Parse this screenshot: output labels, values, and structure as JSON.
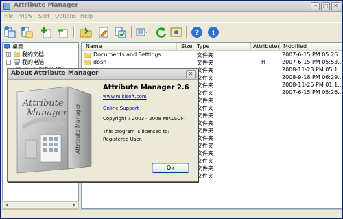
{
  "window": {
    "title": "Attribute Manager"
  },
  "title_buttons": {
    "minimize": "─",
    "maximize": "□",
    "close": "✕"
  },
  "menu": [
    "File",
    "View",
    "Sort",
    "Options",
    "Help"
  ],
  "toolbar_icons": [
    "copy-attributes-icon",
    "paste-attributes-icon",
    "add-icon",
    "remove-icon",
    "open-folder-icon",
    "edit-icon",
    "apply-icon",
    "view-options-icon",
    "refresh-icon",
    "settings-icon",
    "help-icon",
    "info-icon"
  ],
  "tree": {
    "items": [
      {
        "label": "桌面",
        "level": 0,
        "expander": ""
      },
      {
        "label": "我的文档",
        "level": 1,
        "expander": "+"
      },
      {
        "label": "我的电脑",
        "level": 1,
        "expander": "−"
      },
      {
        "label": "本地磁盘 (C:)",
        "level": 2,
        "expander": "+"
      }
    ]
  },
  "list": {
    "columns": [
      "Name",
      "Size",
      "Type",
      "Attributes",
      "Modified"
    ],
    "rows": [
      {
        "name": "Documents and Settings",
        "size": "",
        "type": "文件夹",
        "attributes": "",
        "modified": "2007-6-15 PM 05:26..."
      },
      {
        "name": "dosh",
        "size": "",
        "type": "文件夹",
        "attributes": "H",
        "modified": "2007-6-15 PM 05:53..."
      },
      {
        "name": "",
        "size": "",
        "type": "文件夹",
        "attributes": "",
        "modified": "2008-11-23 PM 05:1..."
      },
      {
        "name": "",
        "size": "",
        "type": "文件夹",
        "attributes": "",
        "modified": "2008-9-18 PM 06:29..."
      },
      {
        "name": "",
        "size": "",
        "type": "文件夹",
        "attributes": "",
        "modified": "2008-11-25 PM 01:1..."
      },
      {
        "name": "",
        "size": "",
        "type": "文件夹",
        "attributes": "",
        "modified": "2007-6-15 PM 05:26..."
      },
      {
        "name": "",
        "size": "",
        "type": "文件夹",
        "attributes": "",
        "modified": ""
      },
      {
        "name": "",
        "size": "",
        "type": "文件夹",
        "attributes": "",
        "modified": ""
      },
      {
        "name": "",
        "size": "",
        "type": "文件夹",
        "attributes": "",
        "modified": ""
      },
      {
        "name": "",
        "size": "",
        "type": "文件夹",
        "attributes": "",
        "modified": ""
      },
      {
        "name": "",
        "size": "",
        "type": "文件夹",
        "attributes": "",
        "modified": ""
      },
      {
        "name": "",
        "size": "",
        "type": "文件夹",
        "attributes": "",
        "modified": ""
      },
      {
        "name": "",
        "size": "",
        "type": "文件夹",
        "attributes": "",
        "modified": ""
      },
      {
        "name": "",
        "size": "",
        "type": "文件夹",
        "attributes": "",
        "modified": ""
      },
      {
        "name": "",
        "size": "",
        "type": "文件夹",
        "attributes": "",
        "modified": ""
      },
      {
        "name": "",
        "size": "",
        "type": "文件夹",
        "attributes": "",
        "modified": ""
      },
      {
        "name": "",
        "size": "",
        "type": "文件夹",
        "attributes": "",
        "modified": ""
      }
    ]
  },
  "about": {
    "title": "About Attribute Manager",
    "close": "✕",
    "box_art_text": "Attribute Manager",
    "product": "Attribute Manager 2.6",
    "url": "www.miklsoft.com",
    "support": "Online Support",
    "copyright": "Copyright ? 2003 - 2008 MIKLSOFT",
    "license_line1": "This program is licensed to:",
    "license_line2": "Registered User.",
    "ok": "Ok"
  },
  "colors": {
    "link": "#0000cc",
    "folder": "#f2d372",
    "selection_border": "#7f9db9"
  }
}
